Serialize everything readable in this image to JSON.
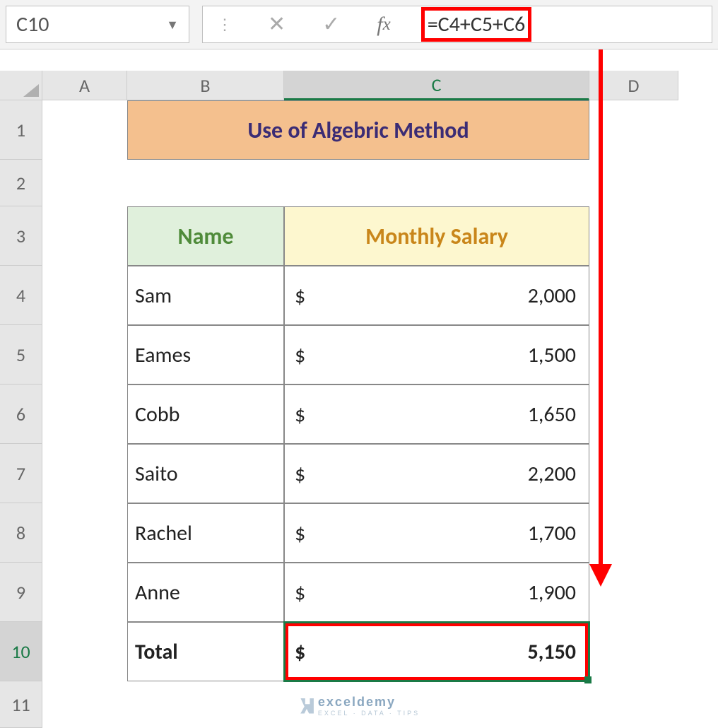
{
  "namebox": {
    "cell_ref": "C10"
  },
  "formula_bar": {
    "formula": "=C4+C5+C6"
  },
  "columns": {
    "A": "A",
    "B": "B",
    "C": "C",
    "D": "D"
  },
  "rows": [
    "1",
    "2",
    "3",
    "4",
    "5",
    "6",
    "7",
    "8",
    "9",
    "10",
    "11"
  ],
  "title": "Use of Algebric Method",
  "headers": {
    "name": "Name",
    "salary": "Monthly Salary"
  },
  "currency": "$",
  "data": [
    {
      "name": "Sam",
      "salary": "2,000"
    },
    {
      "name": "Eames",
      "salary": "1,500"
    },
    {
      "name": "Cobb",
      "salary": "1,650"
    },
    {
      "name": "Saito",
      "salary": "2,200"
    },
    {
      "name": "Rachel",
      "salary": "1,700"
    },
    {
      "name": "Anne",
      "salary": "1,900"
    }
  ],
  "total": {
    "label": "Total",
    "value": "5,150"
  },
  "watermark": {
    "brand": "exceldemy",
    "tag": "EXCEL · DATA · TIPS"
  },
  "chart_data": {
    "type": "table",
    "title": "Use of Algebric Method",
    "columns": [
      "Name",
      "Monthly Salary"
    ],
    "rows": [
      [
        "Sam",
        2000
      ],
      [
        "Eames",
        1500
      ],
      [
        "Cobb",
        1650
      ],
      [
        "Saito",
        2200
      ],
      [
        "Rachel",
        1700
      ],
      [
        "Anne",
        1900
      ],
      [
        "Total",
        5150
      ]
    ],
    "formula": "=C4+C5+C6",
    "active_cell": "C10"
  }
}
